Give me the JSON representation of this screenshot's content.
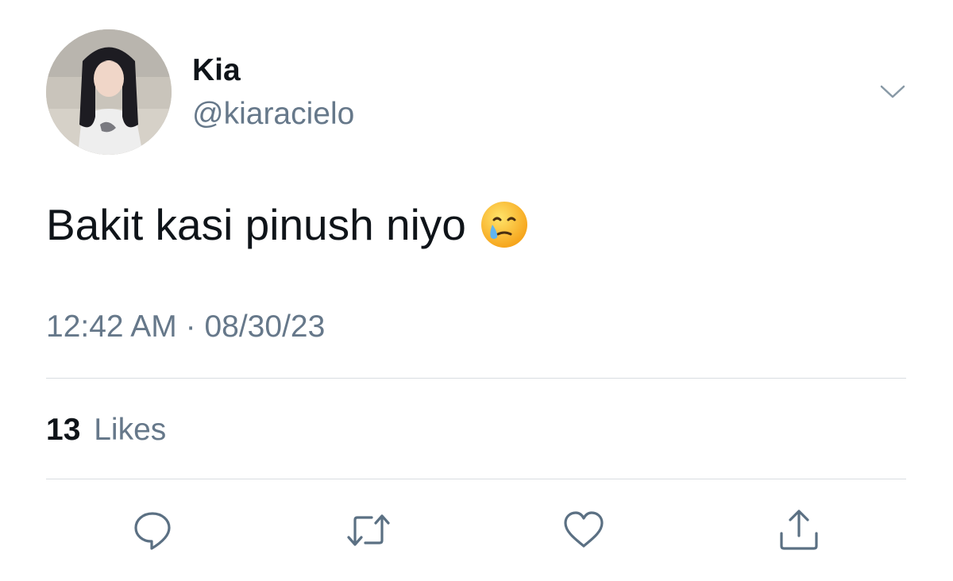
{
  "user": {
    "display_name": "Kia",
    "handle": "@kiaracielo",
    "avatar_icon": "profile-photo"
  },
  "tweet": {
    "text": "Bakit kasi pinush niyo",
    "emoji": "face-holding-back-tears-icon"
  },
  "meta": {
    "time": "12:42 AM",
    "separator": "·",
    "date": "08/30/23"
  },
  "stats": {
    "likes_count": "13",
    "likes_label": "Likes"
  },
  "actions": {
    "reply_icon": "reply-icon",
    "retweet_icon": "retweet-icon",
    "like_icon": "heart-icon",
    "share_icon": "share-icon"
  },
  "colors": {
    "text": "#0f1419",
    "secondary": "#66788a",
    "divider": "#d9dde1",
    "icon": "#5b7083"
  }
}
